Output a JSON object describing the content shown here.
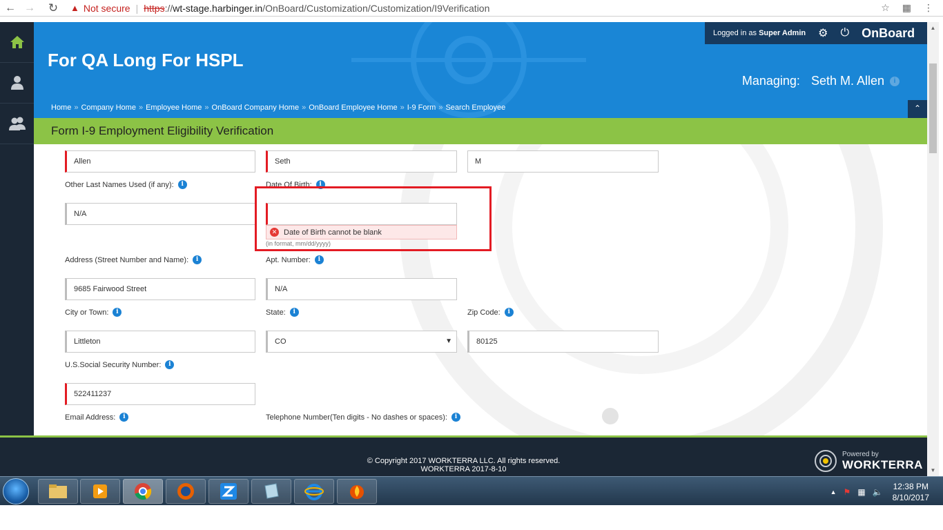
{
  "browser": {
    "security_label": "Not secure",
    "url_scheme": "https",
    "url_rest": "://",
    "url_host": "wt-stage.harbinger.in",
    "url_path": "/OnBoard/Customization/Customization/I9Verification"
  },
  "header": {
    "company": "For QA Long For HSPL",
    "logged_in_prefix": "Logged in as",
    "logged_in_user": "Super Admin",
    "app_name": "OnBoard",
    "managing_label": "Managing:",
    "managing_name": "Seth M. Allen"
  },
  "breadcrumbs": [
    "Home",
    "Company Home",
    "Employee Home",
    "OnBoard Company Home",
    "OnBoard Employee Home",
    "I-9 Form",
    "Search Employee"
  ],
  "breadcrumb_separator": "»",
  "form": {
    "title": "Form I-9 Employment Eligibility Verification",
    "last_name_value": "Allen",
    "first_name_value": "Seth",
    "middle_initial_value": "M",
    "other_names_label": "Other Last Names Used (if any):",
    "other_names_value": "N/A",
    "dob_label": "Date Of Birth:",
    "dob_value": "",
    "dob_error": "Date of Birth cannot be blank",
    "dob_hint": "(in format, mm/dd/yyyy)",
    "address_label": "Address (Street Number and Name):",
    "address_value": "9685 Fairwood Street",
    "apt_label": "Apt. Number:",
    "apt_value": "N/A",
    "city_label": "City or Town:",
    "city_value": "Littleton",
    "state_label": "State:",
    "state_value": "CO",
    "zip_label": "Zip Code:",
    "zip_value": "80125",
    "ssn_label": "U.S.Social Security Number:",
    "ssn_value": "522411237",
    "email_label": "Email Address:",
    "phone_label": "Telephone Number(Ten digits - No dashes or spaces):"
  },
  "footer": {
    "copyright": "© Copyright 2017 WORKTERRA LLC. All rights reserved.",
    "version": "WORKTERRA 2017-8-10",
    "powered_by": "Powered by",
    "brand": "WORKTERRA"
  },
  "taskbar": {
    "time": "12:38 PM",
    "date": "8/10/2017"
  },
  "colors": {
    "header_blue": "#1a86d6",
    "title_green": "#8cc346",
    "nav_dark": "#1b2735",
    "required_red": "#e31b23"
  }
}
